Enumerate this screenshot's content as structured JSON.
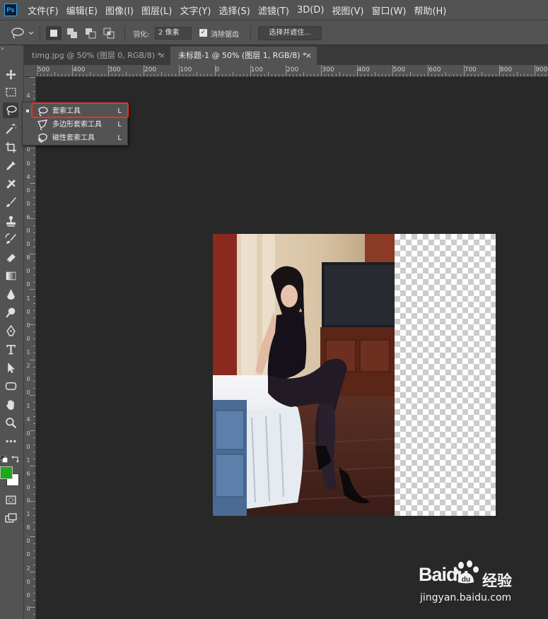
{
  "app": {
    "logo": "Ps"
  },
  "menu": [
    "文件(F)",
    "编辑(E)",
    "图像(I)",
    "图层(L)",
    "文字(Y)",
    "选择(S)",
    "滤镜(T)",
    "3D(D)",
    "视图(V)",
    "窗口(W)",
    "帮助(H)"
  ],
  "options": {
    "feather_label": "羽化:",
    "feather_value": "2 像素",
    "antialias_label": "消除锯齿",
    "antialias_checked": true,
    "select_mask_button": "选择并遮住..."
  },
  "tabs": [
    {
      "label": "timg.jpg @ 50% (图层 0, RGB/8) *",
      "close": "×",
      "active": false
    },
    {
      "label": "未标题-1 @ 50% (图层 1, RGB/8) *",
      "close": "×",
      "active": true
    }
  ],
  "colors": {
    "foreground": "#1aaa1a",
    "background": "#ffffff",
    "highlight": "#e8322b"
  },
  "ruler_h": [
    "500",
    "400",
    "300",
    "200",
    "100",
    "0",
    "100",
    "200",
    "300",
    "400",
    "500",
    "600",
    "700",
    "800",
    "900"
  ],
  "ruler_v": [
    "4",
    "2",
    "0",
    "2",
    "0",
    "0",
    "4",
    "0",
    "0",
    "6",
    "0",
    "0",
    "8",
    "0",
    "0",
    "1",
    "0",
    "0",
    "0",
    "1",
    "2",
    "0",
    "0",
    "1",
    "4",
    "0",
    "0",
    "1",
    "6",
    "0",
    "0",
    "1",
    "8",
    "0",
    "0",
    "2",
    "0",
    "0",
    "0"
  ],
  "flyout": {
    "items": [
      {
        "label": "套索工具",
        "shortcut": "L",
        "icon": "lasso-icon"
      },
      {
        "label": "多边形套索工具",
        "shortcut": "L",
        "icon": "polygonal-lasso-icon"
      },
      {
        "label": "磁性套索工具",
        "shortcut": "L",
        "icon": "magnetic-lasso-icon"
      }
    ]
  },
  "watermark": {
    "brand": "Baidu",
    "product": "经验",
    "url": "jingyan.baidu.com"
  }
}
